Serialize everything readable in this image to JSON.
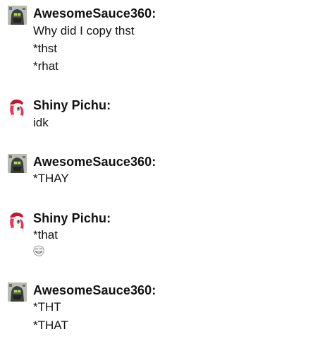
{
  "messages": [
    {
      "username": "AwesomeSauce360:",
      "avatar_icon": "robot-avatar-icon",
      "lines": [
        "Why did I copy thst",
        "*thst",
        "*rhat"
      ]
    },
    {
      "username": "Shiny Pichu:",
      "avatar_icon": "pony-avatar-icon",
      "lines": [
        "idk"
      ]
    },
    {
      "username": "AwesomeSauce360:",
      "avatar_icon": "robot-avatar-icon",
      "lines": [
        "*THAY"
      ]
    },
    {
      "username": "Shiny Pichu:",
      "avatar_icon": "pony-avatar-icon",
      "lines": [
        "*that"
      ],
      "emoji": "trollface-emoji-icon"
    },
    {
      "username": "AwesomeSauce360:",
      "avatar_icon": "robot-avatar-icon",
      "lines": [
        "*THT",
        "*THAT"
      ]
    }
  ],
  "colors": {
    "text": "#111111",
    "background": "#ffffff",
    "pony_hair": "#e0395a",
    "pony_hat": "#c8162c",
    "robot_dark": "#3d3f3a"
  }
}
